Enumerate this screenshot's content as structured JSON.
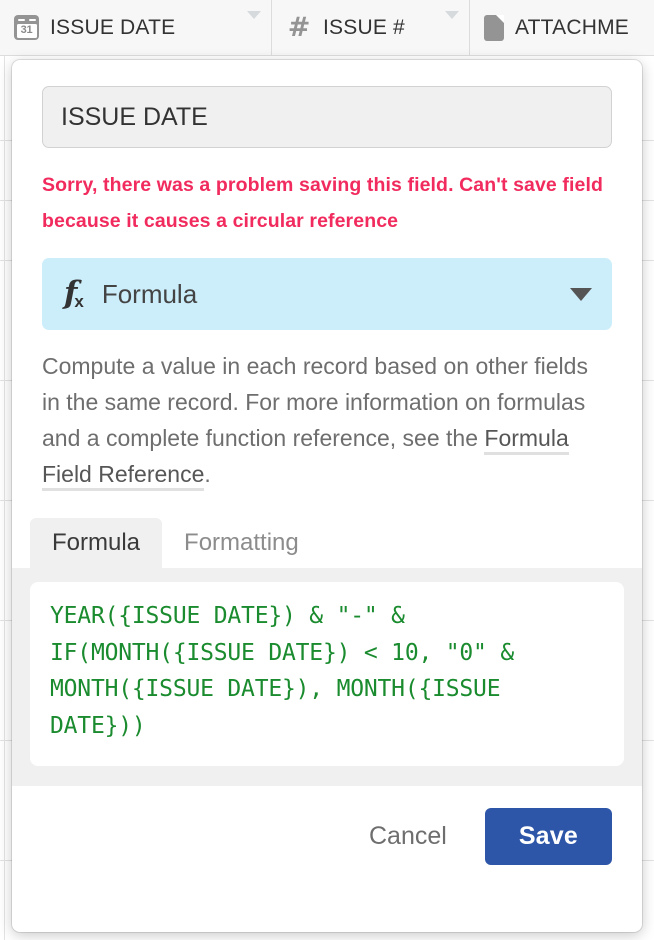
{
  "grid": {
    "row_line_tops": [
      56,
      140,
      200,
      260,
      380,
      500,
      620,
      740,
      860
    ],
    "col_line_lefts": [
      4,
      272,
      470
    ]
  },
  "field_header_bar": {
    "columns": [
      {
        "icon": "calendar-31-icon",
        "icon_text": "31",
        "label": "ISSUE DATE",
        "has_caret": true
      },
      {
        "icon": "hash-icon",
        "icon_text": "#",
        "label": "ISSUE #",
        "has_caret": true
      },
      {
        "icon": "attachment-doc-icon",
        "icon_text": "",
        "label": "ATTACHME",
        "has_caret": false
      }
    ]
  },
  "field_editor": {
    "name_input": {
      "value": "ISSUE DATE",
      "placeholder": "Field name (optional)"
    },
    "error_message": "Sorry, there was a problem saving this field. Can't save field because it causes a circular reference",
    "error_color": "#f12b5e",
    "type_select": {
      "icon": "fx-icon",
      "fx_letter": "f",
      "fx_subscript": "x",
      "label": "Formula",
      "background_color": "#cceefb"
    },
    "type_description": {
      "text_before_link": "Compute a value in each record based on other fields in the same record. For more information on formulas and a complete function reference, see the ",
      "link_text": "Formula Field Reference",
      "text_after_link": "."
    },
    "tabs": [
      {
        "label": "Formula",
        "active": true
      },
      {
        "label": "Formatting",
        "active": false
      }
    ],
    "formula_editor": {
      "code": "YEAR({ISSUE DATE}) & \"-\" & IF(MONTH({ISSUE DATE}) < 10, \"0\" & MONTH({ISSUE DATE}), MONTH({ISSUE DATE}))",
      "code_color": "#1a8b2e"
    },
    "footer": {
      "cancel_label": "Cancel",
      "save_label": "Save",
      "save_color": "#2d55a8"
    }
  }
}
